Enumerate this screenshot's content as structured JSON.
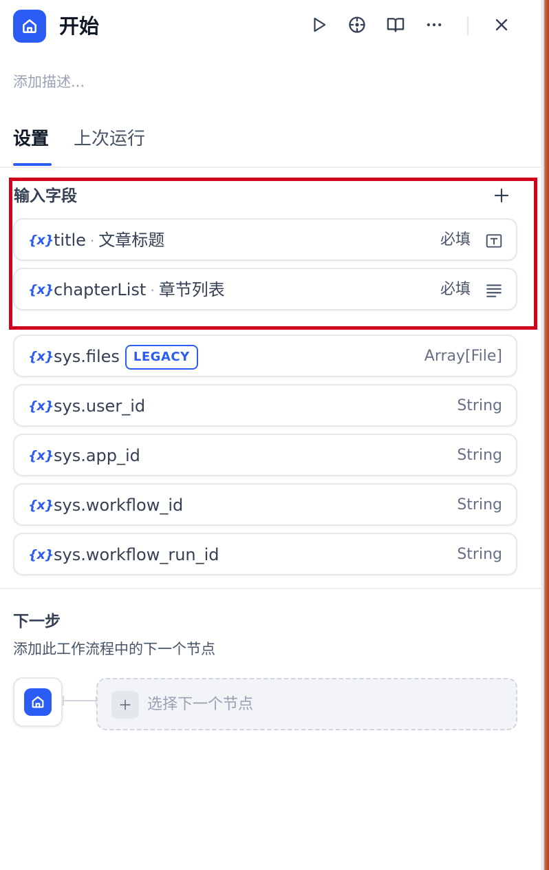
{
  "header": {
    "title": "开始",
    "icons": {
      "node": "home-icon",
      "run": "play-icon",
      "locate": "crosshair-icon",
      "docs": "book-icon",
      "more": "more-icon",
      "close": "close-icon"
    }
  },
  "description_placeholder": "添加描述...",
  "tabs": [
    {
      "label": "设置",
      "active": true
    },
    {
      "label": "上次运行",
      "active": false
    }
  ],
  "input_section": {
    "title": "输入字段",
    "user_vars": [
      {
        "icon": "{x}",
        "name": "title",
        "separator": "·",
        "label": "文章标题",
        "required": "必填",
        "type_icon": "text-input-icon"
      },
      {
        "icon": "{x}",
        "name": "chapterList",
        "separator": "·",
        "label": "章节列表",
        "required": "必填",
        "type_icon": "paragraph-icon"
      }
    ],
    "system_vars": [
      {
        "icon": "{x}",
        "name": "sys.files",
        "badge": "LEGACY",
        "type": "Array[File]"
      },
      {
        "icon": "{x}",
        "name": "sys.user_id",
        "type": "String"
      },
      {
        "icon": "{x}",
        "name": "sys.app_id",
        "type": "String"
      },
      {
        "icon": "{x}",
        "name": "sys.workflow_id",
        "type": "String"
      },
      {
        "icon": "{x}",
        "name": "sys.workflow_run_id",
        "type": "String"
      }
    ]
  },
  "next_step": {
    "title": "下一步",
    "subtitle": "添加此工作流程中的下一个节点",
    "select_label": "选择下一个节点"
  },
  "colors": {
    "accent": "#2b5cf3",
    "highlight_border": "#d0021b"
  }
}
